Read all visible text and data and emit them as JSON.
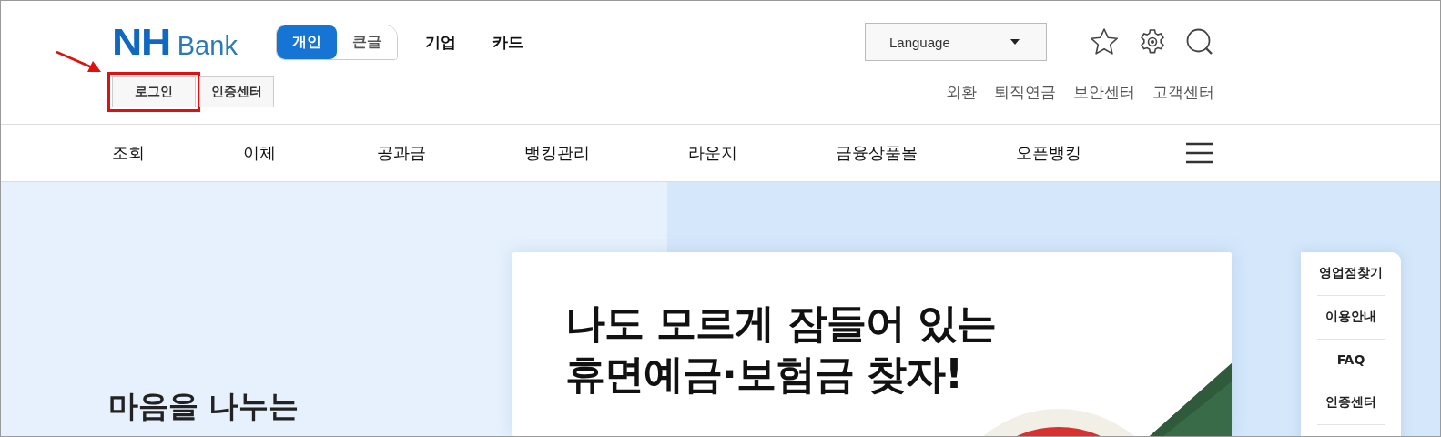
{
  "header": {
    "logo": {
      "mark": "NH",
      "name": "Bank"
    },
    "modes": [
      {
        "label": "개인",
        "selected": true
      },
      {
        "label": "큰글",
        "selected": false
      }
    ],
    "sections": [
      "기업",
      "카드"
    ],
    "language": {
      "value": "Language"
    },
    "auth_buttons": [
      {
        "label": "로그인",
        "highlighted": true
      },
      {
        "label": "인증센터",
        "highlighted": false
      }
    ],
    "utility_links": [
      "외환",
      "퇴직연금",
      "보안센터",
      "고객센터"
    ]
  },
  "nav": {
    "items": [
      "조회",
      "이체",
      "공과금",
      "뱅킹관리",
      "라운지",
      "금융상품몰",
      "오픈뱅킹"
    ]
  },
  "hero": {
    "heading": "마음을 나누는",
    "banner": {
      "kind": "picture",
      "headline": [
        "나도 모르게 잠들어 있는",
        "휴면예금·보험금 찾자!"
      ]
    }
  },
  "quick_menu": [
    "영업점찾기",
    "이용안내",
    "FAQ",
    "인증센터"
  ]
}
